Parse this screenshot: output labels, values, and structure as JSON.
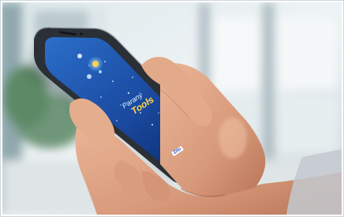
{
  "photo": {
    "subject": "hand holding smartphone showing blue app splash screen",
    "background": "blurred bright office window",
    "colors": {
      "screen_dark": "#0b2a6b",
      "screen_light": "#2f7fd6",
      "phone_frame": "#2b2f36",
      "skin": "#e2a987",
      "skin_shadow": "#b97457",
      "bg_light": "#eef3f6",
      "bg_mid": "#c5d3d8",
      "plant_green": "#5d8a66"
    }
  },
  "app_screen": {
    "title_line1": "Paraný",
    "title_line2": "Tools",
    "corner_logo": "Zilo"
  }
}
